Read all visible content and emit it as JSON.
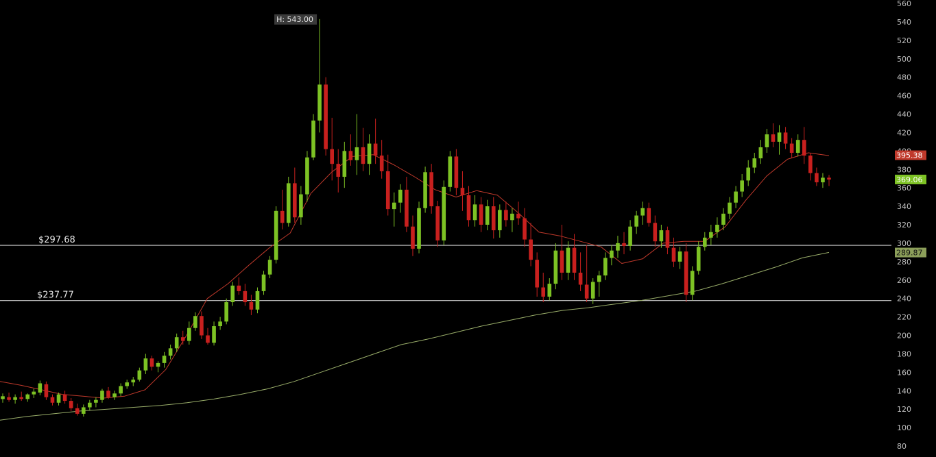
{
  "chart_data": {
    "type": "candlestick",
    "title": "",
    "xlabel": "",
    "ylabel": "",
    "ylim": [
      80,
      560
    ],
    "y_ticks": [
      80,
      100,
      120,
      140,
      160,
      180,
      200,
      220,
      240,
      260,
      280,
      300,
      320,
      340,
      360,
      380,
      400,
      420,
      440,
      460,
      480,
      500,
      520,
      540,
      560
    ],
    "y_axis_side": "right",
    "grid": false,
    "colors": {
      "background": "#000000",
      "up": "#7dc224",
      "down": "#c8201e",
      "ma_short": "#c0392b",
      "ma_long": "#9aae6a",
      "level_line": "#cfcfcf",
      "tick_text": "#bfbfbf"
    },
    "high_marker": {
      "label": "H: 543.00",
      "value": 543.0
    },
    "horizontal_levels": [
      {
        "label": "$297.68",
        "value": 297.68
      },
      {
        "label": "$237.77",
        "value": 237.77
      }
    ],
    "price_badges": [
      {
        "label": "395.38",
        "value": 395.38,
        "color": "#c0392b",
        "text_color": "#ffffff"
      },
      {
        "label": "369.06",
        "value": 369.06,
        "color": "#7dc224",
        "text_color": "#ffffff"
      },
      {
        "label": "289.87",
        "value": 289.87,
        "color": "#8c9f5a",
        "text_color": "#111111"
      }
    ],
    "ma_short": [
      150,
      146,
      141,
      136,
      134,
      132,
      134,
      141,
      163,
      200,
      240,
      256,
      276,
      295,
      311,
      354,
      377,
      394,
      396,
      385,
      372,
      358,
      350,
      357,
      352,
      333,
      312,
      308,
      302,
      296,
      278,
      283,
      300,
      302,
      302,
      318,
      347,
      373,
      391,
      398,
      395
    ],
    "ma_long": [
      108,
      112,
      115,
      118,
      120,
      122,
      124,
      127,
      131,
      136,
      142,
      150,
      160,
      170,
      180,
      190,
      196,
      203,
      210,
      216,
      222,
      227,
      230,
      234,
      238,
      243,
      248,
      256,
      265,
      274,
      284,
      290
    ],
    "candles": [
      {
        "o": 131,
        "h": 137,
        "l": 127,
        "c": 134
      },
      {
        "o": 133,
        "h": 138,
        "l": 128,
        "c": 130
      },
      {
        "o": 130,
        "h": 136,
        "l": 126,
        "c": 133
      },
      {
        "o": 133,
        "h": 139,
        "l": 129,
        "c": 131
      },
      {
        "o": 131,
        "h": 137,
        "l": 128,
        "c": 136
      },
      {
        "o": 136,
        "h": 142,
        "l": 132,
        "c": 139
      },
      {
        "o": 138,
        "h": 151,
        "l": 135,
        "c": 148
      },
      {
        "o": 147,
        "h": 150,
        "l": 130,
        "c": 133
      },
      {
        "o": 133,
        "h": 136,
        "l": 124,
        "c": 127
      },
      {
        "o": 127,
        "h": 138,
        "l": 124,
        "c": 136
      },
      {
        "o": 136,
        "h": 140,
        "l": 126,
        "c": 129
      },
      {
        "o": 129,
        "h": 132,
        "l": 118,
        "c": 121
      },
      {
        "o": 121,
        "h": 126,
        "l": 113,
        "c": 115
      },
      {
        "o": 115,
        "h": 125,
        "l": 112,
        "c": 122
      },
      {
        "o": 122,
        "h": 130,
        "l": 119,
        "c": 127
      },
      {
        "o": 127,
        "h": 133,
        "l": 122,
        "c": 130
      },
      {
        "o": 130,
        "h": 142,
        "l": 127,
        "c": 140
      },
      {
        "o": 140,
        "h": 144,
        "l": 131,
        "c": 133
      },
      {
        "o": 133,
        "h": 140,
        "l": 130,
        "c": 137
      },
      {
        "o": 137,
        "h": 148,
        "l": 134,
        "c": 145
      },
      {
        "o": 145,
        "h": 152,
        "l": 142,
        "c": 149
      },
      {
        "o": 149,
        "h": 155,
        "l": 145,
        "c": 152
      },
      {
        "o": 152,
        "h": 165,
        "l": 150,
        "c": 162
      },
      {
        "o": 162,
        "h": 180,
        "l": 158,
        "c": 175
      },
      {
        "o": 175,
        "h": 178,
        "l": 162,
        "c": 166
      },
      {
        "o": 166,
        "h": 172,
        "l": 160,
        "c": 170
      },
      {
        "o": 170,
        "h": 182,
        "l": 165,
        "c": 178
      },
      {
        "o": 178,
        "h": 190,
        "l": 174,
        "c": 186
      },
      {
        "o": 186,
        "h": 202,
        "l": 182,
        "c": 198
      },
      {
        "o": 198,
        "h": 205,
        "l": 190,
        "c": 194
      },
      {
        "o": 194,
        "h": 215,
        "l": 190,
        "c": 208
      },
      {
        "o": 208,
        "h": 225,
        "l": 205,
        "c": 221
      },
      {
        "o": 221,
        "h": 226,
        "l": 196,
        "c": 200
      },
      {
        "o": 200,
        "h": 208,
        "l": 190,
        "c": 192
      },
      {
        "o": 192,
        "h": 215,
        "l": 189,
        "c": 210
      },
      {
        "o": 210,
        "h": 220,
        "l": 206,
        "c": 215
      },
      {
        "o": 215,
        "h": 240,
        "l": 212,
        "c": 236
      },
      {
        "o": 236,
        "h": 258,
        "l": 232,
        "c": 254
      },
      {
        "o": 254,
        "h": 263,
        "l": 244,
        "c": 248
      },
      {
        "o": 248,
        "h": 256,
        "l": 232,
        "c": 236
      },
      {
        "o": 236,
        "h": 244,
        "l": 222,
        "c": 228
      },
      {
        "o": 228,
        "h": 252,
        "l": 224,
        "c": 248
      },
      {
        "o": 248,
        "h": 270,
        "l": 244,
        "c": 266
      },
      {
        "o": 266,
        "h": 286,
        "l": 262,
        "c": 282
      },
      {
        "o": 282,
        "h": 340,
        "l": 278,
        "c": 335
      },
      {
        "o": 335,
        "h": 358,
        "l": 315,
        "c": 322
      },
      {
        "o": 322,
        "h": 372,
        "l": 318,
        "c": 365
      },
      {
        "o": 365,
        "h": 382,
        "l": 322,
        "c": 328
      },
      {
        "o": 328,
        "h": 362,
        "l": 320,
        "c": 353
      },
      {
        "o": 353,
        "h": 400,
        "l": 345,
        "c": 393
      },
      {
        "o": 393,
        "h": 440,
        "l": 390,
        "c": 433
      },
      {
        "o": 433,
        "h": 543,
        "l": 420,
        "c": 472
      },
      {
        "o": 472,
        "h": 480,
        "l": 395,
        "c": 402
      },
      {
        "o": 402,
        "h": 436,
        "l": 368,
        "c": 386
      },
      {
        "o": 386,
        "h": 402,
        "l": 355,
        "c": 372
      },
      {
        "o": 372,
        "h": 410,
        "l": 360,
        "c": 400
      },
      {
        "o": 400,
        "h": 418,
        "l": 384,
        "c": 390
      },
      {
        "o": 390,
        "h": 440,
        "l": 374,
        "c": 404
      },
      {
        "o": 404,
        "h": 425,
        "l": 378,
        "c": 386
      },
      {
        "o": 386,
        "h": 418,
        "l": 374,
        "c": 408
      },
      {
        "o": 408,
        "h": 435,
        "l": 386,
        "c": 395
      },
      {
        "o": 395,
        "h": 412,
        "l": 370,
        "c": 378
      },
      {
        "o": 378,
        "h": 396,
        "l": 330,
        "c": 337
      },
      {
        "o": 337,
        "h": 355,
        "l": 318,
        "c": 344
      },
      {
        "o": 344,
        "h": 364,
        "l": 333,
        "c": 358
      },
      {
        "o": 358,
        "h": 372,
        "l": 312,
        "c": 318
      },
      {
        "o": 318,
        "h": 330,
        "l": 286,
        "c": 294
      },
      {
        "o": 294,
        "h": 345,
        "l": 289,
        "c": 338
      },
      {
        "o": 338,
        "h": 383,
        "l": 333,
        "c": 377
      },
      {
        "o": 377,
        "h": 386,
        "l": 332,
        "c": 340
      },
      {
        "o": 340,
        "h": 346,
        "l": 296,
        "c": 303
      },
      {
        "o": 303,
        "h": 368,
        "l": 298,
        "c": 361
      },
      {
        "o": 361,
        "h": 400,
        "l": 356,
        "c": 394
      },
      {
        "o": 394,
        "h": 402,
        "l": 352,
        "c": 360
      },
      {
        "o": 360,
        "h": 378,
        "l": 335,
        "c": 352
      },
      {
        "o": 352,
        "h": 362,
        "l": 318,
        "c": 325
      },
      {
        "o": 325,
        "h": 352,
        "l": 318,
        "c": 342
      },
      {
        "o": 342,
        "h": 350,
        "l": 312,
        "c": 320
      },
      {
        "o": 320,
        "h": 347,
        "l": 314,
        "c": 340
      },
      {
        "o": 340,
        "h": 350,
        "l": 305,
        "c": 314
      },
      {
        "o": 314,
        "h": 342,
        "l": 306,
        "c": 336
      },
      {
        "o": 336,
        "h": 345,
        "l": 318,
        "c": 325
      },
      {
        "o": 325,
        "h": 338,
        "l": 312,
        "c": 332
      },
      {
        "o": 332,
        "h": 345,
        "l": 320,
        "c": 327
      },
      {
        "o": 327,
        "h": 338,
        "l": 296,
        "c": 304
      },
      {
        "o": 304,
        "h": 322,
        "l": 275,
        "c": 282
      },
      {
        "o": 282,
        "h": 290,
        "l": 242,
        "c": 252
      },
      {
        "o": 252,
        "h": 268,
        "l": 236,
        "c": 242
      },
      {
        "o": 242,
        "h": 262,
        "l": 238,
        "c": 256
      },
      {
        "o": 256,
        "h": 300,
        "l": 250,
        "c": 292
      },
      {
        "o": 292,
        "h": 320,
        "l": 260,
        "c": 268
      },
      {
        "o": 268,
        "h": 302,
        "l": 260,
        "c": 295
      },
      {
        "o": 295,
        "h": 310,
        "l": 260,
        "c": 268
      },
      {
        "o": 268,
        "h": 290,
        "l": 248,
        "c": 255
      },
      {
        "o": 255,
        "h": 298,
        "l": 236,
        "c": 240
      },
      {
        "o": 240,
        "h": 262,
        "l": 234,
        "c": 258
      },
      {
        "o": 258,
        "h": 270,
        "l": 242,
        "c": 265
      },
      {
        "o": 265,
        "h": 290,
        "l": 260,
        "c": 284
      },
      {
        "o": 284,
        "h": 298,
        "l": 276,
        "c": 292
      },
      {
        "o": 292,
        "h": 308,
        "l": 284,
        "c": 300
      },
      {
        "o": 300,
        "h": 312,
        "l": 288,
        "c": 297
      },
      {
        "o": 297,
        "h": 325,
        "l": 292,
        "c": 318
      },
      {
        "o": 318,
        "h": 335,
        "l": 310,
        "c": 330
      },
      {
        "o": 330,
        "h": 345,
        "l": 320,
        "c": 338
      },
      {
        "o": 338,
        "h": 344,
        "l": 318,
        "c": 322
      },
      {
        "o": 322,
        "h": 330,
        "l": 296,
        "c": 302
      },
      {
        "o": 302,
        "h": 320,
        "l": 295,
        "c": 314
      },
      {
        "o": 314,
        "h": 318,
        "l": 288,
        "c": 295
      },
      {
        "o": 295,
        "h": 306,
        "l": 274,
        "c": 280
      },
      {
        "o": 280,
        "h": 296,
        "l": 272,
        "c": 291
      },
      {
        "o": 291,
        "h": 300,
        "l": 236,
        "c": 244
      },
      {
        "o": 244,
        "h": 275,
        "l": 238,
        "c": 270
      },
      {
        "o": 270,
        "h": 302,
        "l": 266,
        "c": 296
      },
      {
        "o": 296,
        "h": 312,
        "l": 292,
        "c": 306
      },
      {
        "o": 306,
        "h": 320,
        "l": 298,
        "c": 312
      },
      {
        "o": 312,
        "h": 328,
        "l": 306,
        "c": 320
      },
      {
        "o": 320,
        "h": 338,
        "l": 314,
        "c": 332
      },
      {
        "o": 332,
        "h": 350,
        "l": 326,
        "c": 344
      },
      {
        "o": 344,
        "h": 362,
        "l": 338,
        "c": 356
      },
      {
        "o": 356,
        "h": 375,
        "l": 350,
        "c": 368
      },
      {
        "o": 368,
        "h": 390,
        "l": 362,
        "c": 382
      },
      {
        "o": 382,
        "h": 398,
        "l": 376,
        "c": 392
      },
      {
        "o": 392,
        "h": 412,
        "l": 386,
        "c": 404
      },
      {
        "o": 404,
        "h": 424,
        "l": 398,
        "c": 418
      },
      {
        "o": 418,
        "h": 430,
        "l": 404,
        "c": 410
      },
      {
        "o": 410,
        "h": 428,
        "l": 396,
        "c": 420
      },
      {
        "o": 420,
        "h": 426,
        "l": 402,
        "c": 408
      },
      {
        "o": 408,
        "h": 414,
        "l": 392,
        "c": 398
      },
      {
        "o": 398,
        "h": 418,
        "l": 394,
        "c": 412
      },
      {
        "o": 412,
        "h": 426,
        "l": 386,
        "c": 395
      },
      {
        "o": 395,
        "h": 398,
        "l": 368,
        "c": 376
      },
      {
        "o": 376,
        "h": 382,
        "l": 362,
        "c": 366
      },
      {
        "o": 366,
        "h": 376,
        "l": 360,
        "c": 371
      },
      {
        "o": 371,
        "h": 374,
        "l": 362,
        "c": 369
      }
    ]
  }
}
